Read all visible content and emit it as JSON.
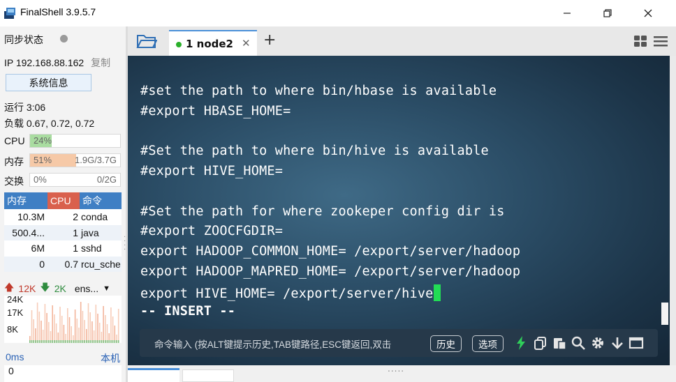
{
  "window": {
    "title": "FinalShell 3.9.5.7"
  },
  "left": {
    "sync_label": "同步状态",
    "ip_text": "IP 192.168.88.162",
    "copy_label": "复制",
    "sysinfo_label": "系统信息",
    "uptime": "运行 3:06",
    "load": "负载 0.67, 0.72, 0.72",
    "cpu": {
      "label": "CPU",
      "value": "24%",
      "fraction": 0.24,
      "color": "#a9dca0"
    },
    "mem": {
      "label": "内存",
      "value": "51%",
      "detail": "1.9G/3.7G",
      "fraction": 0.51,
      "color": "#f6c9a7"
    },
    "swap": {
      "label": "交换",
      "value": "0%",
      "detail": "0/2G",
      "fraction": 0.0
    },
    "proc_table": {
      "headers": [
        "内存",
        "CPU",
        "命令"
      ],
      "header_colors": [
        "#3f7fc4",
        "#d9604d",
        "#3f7fc4"
      ],
      "rows": [
        {
          "mem": "10.3M",
          "cpu": "2",
          "cmd": "conda"
        },
        {
          "mem": "500.4...",
          "cpu": "1",
          "cmd": "java"
        },
        {
          "mem": "6M",
          "cpu": "1",
          "cmd": "sshd"
        },
        {
          "mem": "0",
          "cpu": "0.7",
          "cmd": "rcu_sche"
        }
      ]
    },
    "net": {
      "up": "12K",
      "down": "2K",
      "iface": "ens..."
    },
    "net_axis": [
      "24K",
      "17K",
      "8K"
    ],
    "ping": "0ms",
    "local_label": "本机",
    "ping_value": "0"
  },
  "tabs": [
    {
      "label": "1 node2",
      "close": "✕",
      "status_color": "#2bb02b"
    }
  ],
  "add_tab_label": "+",
  "terminal": {
    "lines": [
      "#set the path to where bin/hbase is available",
      "#export HBASE_HOME=",
      "",
      "#Set the path to where bin/hive is available",
      "#export HIVE_HOME=",
      "",
      "#Set the path for where zookeper config dir is",
      "#export ZOOCFGDIR=",
      "export HADOOP_COMMON_HOME= /export/server/hadoop",
      "export HADOOP_MAPRED_HOME= /export/server/hadoop",
      "export HIVE_HOME= /export/server/hive",
      "-- INSERT --"
    ],
    "cursor_color": "#22dd55"
  },
  "command_bar": {
    "placeholder": "命令输入 (按ALT键提示历史,TAB键路径,ESC键返回,双击",
    "history_label": "历史",
    "options_label": "选项"
  }
}
